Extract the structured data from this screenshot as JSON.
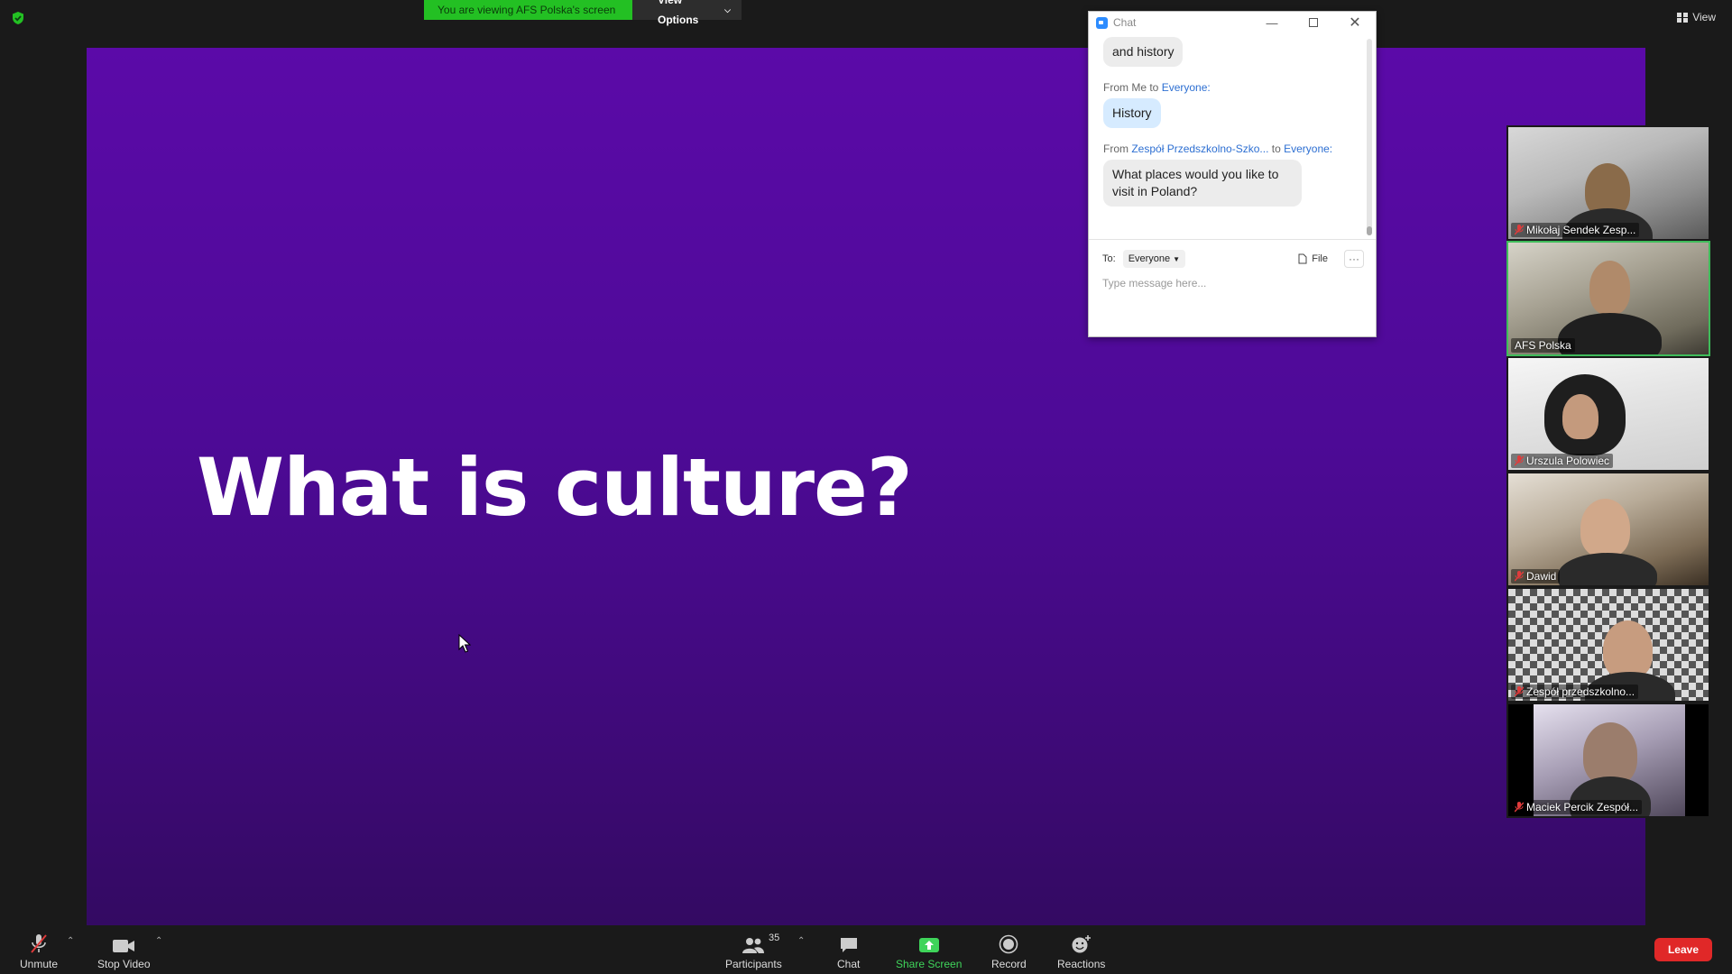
{
  "banner": {
    "viewing": "You are viewing AFS Polska's screen",
    "view_options": "View Options"
  },
  "top_right": {
    "view": "View"
  },
  "slide": {
    "title": "What is culture?"
  },
  "chat": {
    "title": "Chat",
    "messages": [
      {
        "text": "and history",
        "self": false
      },
      {
        "from": "From Me to ",
        "to": "Everyone:",
        "text": "History",
        "self": true
      },
      {
        "from": "From ",
        "sender": "Zespół Przedszkolno-Szko...",
        "mid": " to ",
        "to": "Everyone:",
        "text": "What places would you like to visit in Poland?",
        "self": false
      }
    ],
    "to_label": "To:",
    "recipient": "Everyone",
    "file_label": "File",
    "more": "···",
    "placeholder": "Type message here..."
  },
  "participants_panel": [
    {
      "name": "Mikołaj Sendek Zesp...",
      "muted": true
    },
    {
      "name": "AFS Polska",
      "muted": false,
      "active": true
    },
    {
      "name": "Urszula Polowiec",
      "muted": true
    },
    {
      "name": "Dawid",
      "muted": true
    },
    {
      "name": "Zespół przedszkolno...",
      "muted": true
    },
    {
      "name": "Maciek Percik Zespół...",
      "muted": true
    }
  ],
  "toolbar": {
    "unmute": "Unmute",
    "stop_video": "Stop Video",
    "participants": "Participants",
    "participants_count": "35",
    "chat": "Chat",
    "share_screen": "Share Screen",
    "record": "Record",
    "reactions": "Reactions",
    "leave": "Leave"
  },
  "colors": {
    "accent_green": "#23c023",
    "leave_red": "#e02828",
    "slide_purple": "#5b0aa8",
    "link_blue": "#2d6fd2"
  }
}
